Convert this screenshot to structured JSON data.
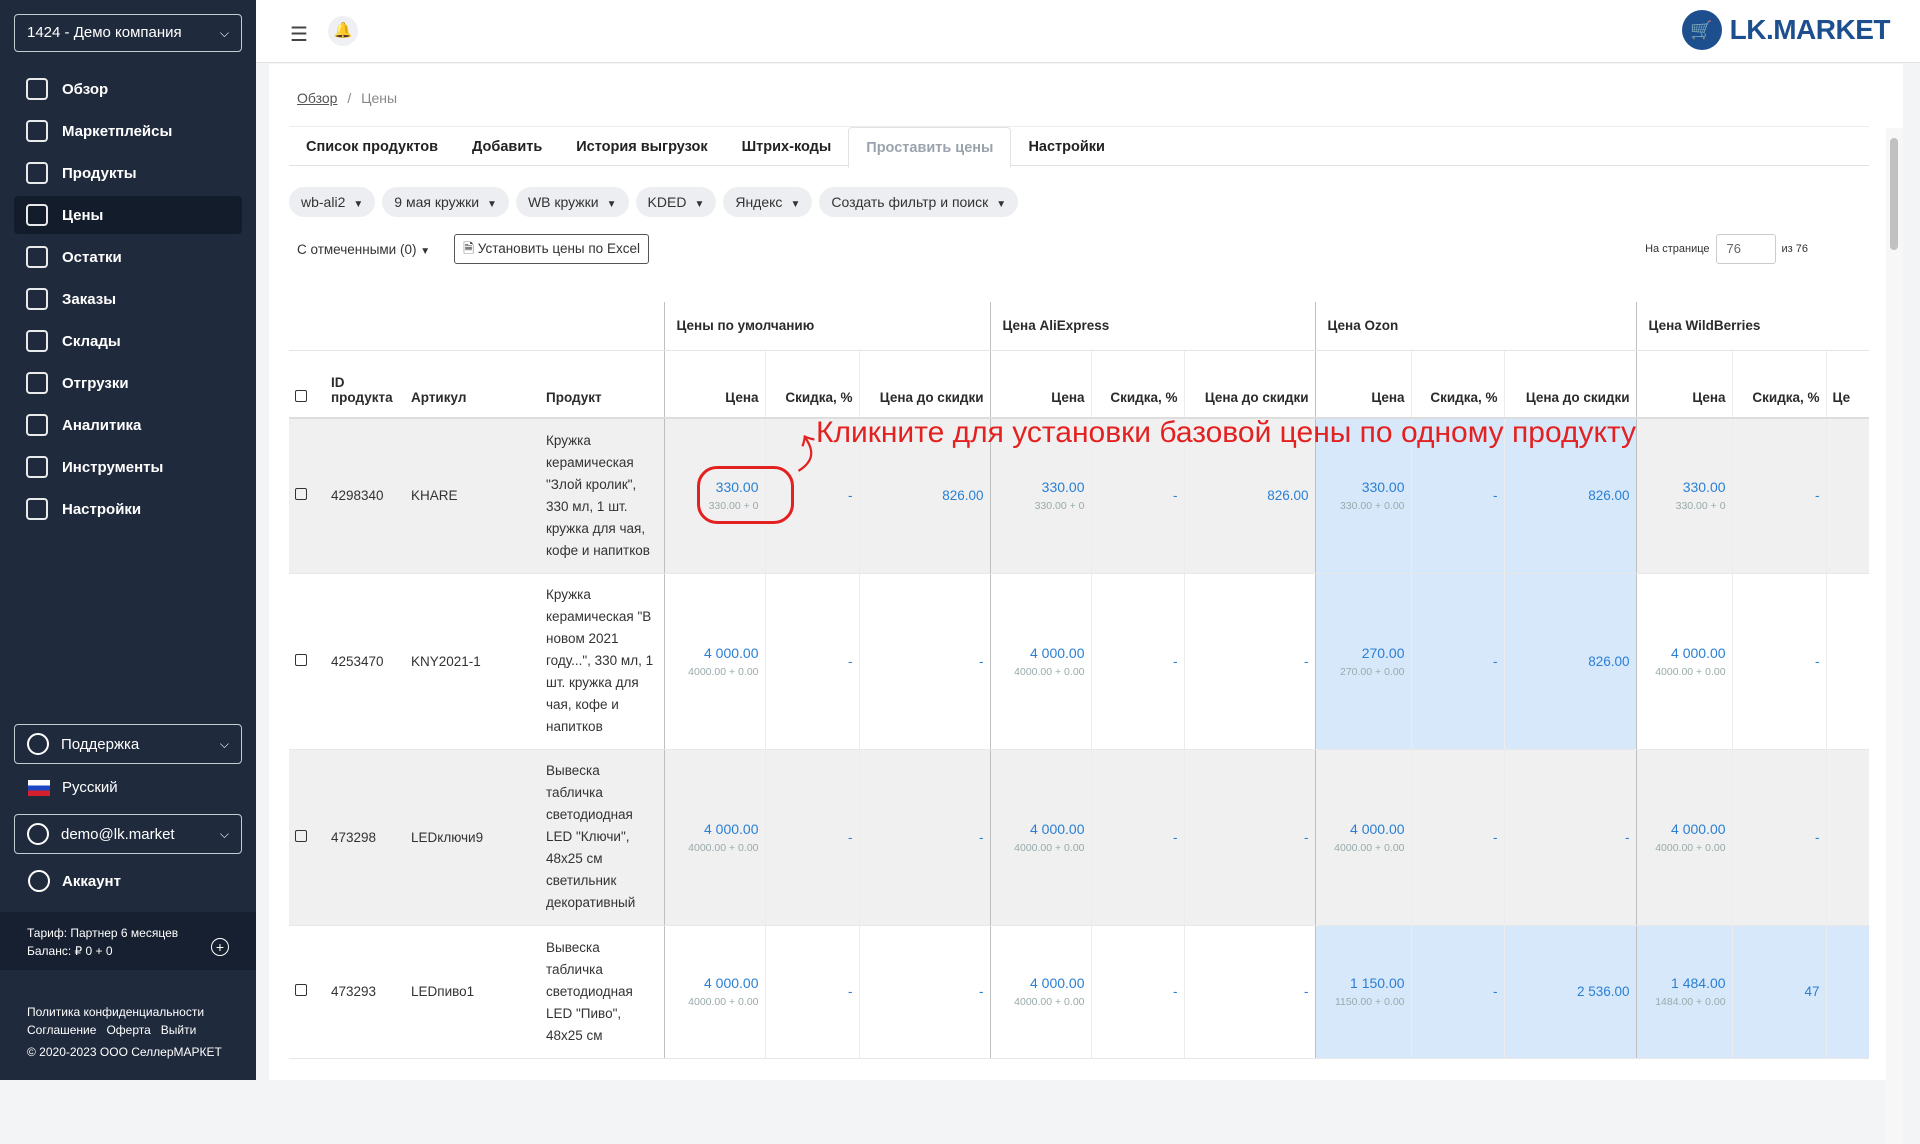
{
  "company": "1424 - Демо компания",
  "nav": [
    {
      "label": "Обзор",
      "icon": "overview-icon"
    },
    {
      "label": "Маркетплейсы",
      "icon": "marketplaces-icon"
    },
    {
      "label": "Продукты",
      "icon": "products-icon"
    },
    {
      "label": "Цены",
      "icon": "prices-icon"
    },
    {
      "label": "Остатки",
      "icon": "stock-icon"
    },
    {
      "label": "Заказы",
      "icon": "orders-icon"
    },
    {
      "label": "Склады",
      "icon": "warehouses-icon"
    },
    {
      "label": "Отгрузки",
      "icon": "shipments-icon"
    },
    {
      "label": "Аналитика",
      "icon": "analytics-icon"
    },
    {
      "label": "Инструменты",
      "icon": "tools-icon"
    },
    {
      "label": "Настройки",
      "icon": "settings-icon"
    }
  ],
  "support": "Поддержка",
  "language": "Русский",
  "user": "demo@lk.market",
  "account": "Аккаунт",
  "tariff": {
    "plan": "Тариф: Партнер 6 месяцев",
    "balance": "Баланс: ₽ 0 + 0"
  },
  "footer": {
    "privacy": "Политика конфиденциальности",
    "agreement": "Соглашение",
    "offer": "Оферта",
    "logout": "Выйти",
    "copyright": "© 2020-2023 ООО СеллерМАРКЕТ"
  },
  "logo": "LK.MARKET",
  "breadcrumb": {
    "home": "Обзор",
    "sep": "/",
    "current": "Цены"
  },
  "tabs": [
    "Список продуктов",
    "Добавить",
    "История выгрузок",
    "Штрих-коды",
    "Проставить цены",
    "Настройки"
  ],
  "filters": [
    "wb-ali2",
    "9 мая кружки",
    "WB кружки",
    "KDED",
    "Яндекс",
    "Создать фильтр и поиск"
  ],
  "actions": {
    "selected": "С отмеченными (0)",
    "excel": "Установить цены по Excel"
  },
  "pagination": {
    "label": "На странице",
    "value": "76",
    "total": "из 76"
  },
  "groups": {
    "default": "Цены по умолчанию",
    "ali": "Цена AliExpress",
    "ozon": "Цена Ozon",
    "wb": "Цена WildBerries"
  },
  "columns": {
    "id": "ID продукта",
    "article": "Артикул",
    "product": "Продукт",
    "price": "Цена",
    "discount": "Скидка, %",
    "before": "Цена до скидки",
    "cut": "Це"
  },
  "annotation": "Кликните для установки базовой цены по одному продукту",
  "rows": [
    {
      "id": "4298340",
      "article": "KHARE",
      "product": "Кружка керамическая \"Злой кролик\", 330 мл, 1 шт. кружка для чая, кофе и напитков",
      "def": {
        "price": "330.00",
        "sub": "330.00 + 0",
        "disc": "-",
        "before": "826.00"
      },
      "ali": {
        "price": "330.00",
        "sub": "330.00 + 0",
        "disc": "-",
        "before": "826.00"
      },
      "ozon": {
        "price": "330.00",
        "sub": "330.00 + 0.00",
        "disc": "-",
        "before": "826.00"
      },
      "wb": {
        "price": "330.00",
        "sub": "330.00 + 0",
        "disc": "-"
      }
    },
    {
      "id": "4253470",
      "article": "KNY2021-1",
      "product": "Кружка керамическая \"В новом 2021 году...\", 330 мл, 1 шт. кружка для чая, кофе и напитков",
      "def": {
        "price": "4 000.00",
        "sub": "4000.00 + 0.00",
        "disc": "-",
        "before": "-"
      },
      "ali": {
        "price": "4 000.00",
        "sub": "4000.00 + 0.00",
        "disc": "-",
        "before": "-"
      },
      "ozon": {
        "price": "270.00",
        "sub": "270.00 + 0.00",
        "disc": "-",
        "before": "826.00"
      },
      "wb": {
        "price": "4 000.00",
        "sub": "4000.00 + 0.00",
        "disc": "-"
      }
    },
    {
      "id": "473298",
      "article": "LEDключи9",
      "product": "Вывеска табличка светодиодная LED \"Ключи\", 48x25 см светильник декоративный",
      "def": {
        "price": "4 000.00",
        "sub": "4000.00 + 0.00",
        "disc": "-",
        "before": "-"
      },
      "ali": {
        "price": "4 000.00",
        "sub": "4000.00 + 0.00",
        "disc": "-",
        "before": "-"
      },
      "ozon": {
        "price": "4 000.00",
        "sub": "4000.00 + 0.00",
        "disc": "-",
        "before": "-"
      },
      "wb": {
        "price": "4 000.00",
        "sub": "4000.00 + 0.00",
        "disc": "-"
      }
    },
    {
      "id": "473293",
      "article": "LEDпиво1",
      "product": "Вывеска табличка светодиодная LED \"Пиво\", 48x25 см",
      "def": {
        "price": "4 000.00",
        "sub": "4000.00 + 0.00",
        "disc": "-",
        "before": "-"
      },
      "ali": {
        "price": "4 000.00",
        "sub": "4000.00 + 0.00",
        "disc": "-",
        "before": "-"
      },
      "ozon": {
        "price": "1 150.00",
        "sub": "1150.00 + 0.00",
        "disc": "-",
        "before": "2 536.00"
      },
      "wb": {
        "price": "1 484.00",
        "sub": "1484.00 + 0.00",
        "disc": "47"
      }
    }
  ]
}
